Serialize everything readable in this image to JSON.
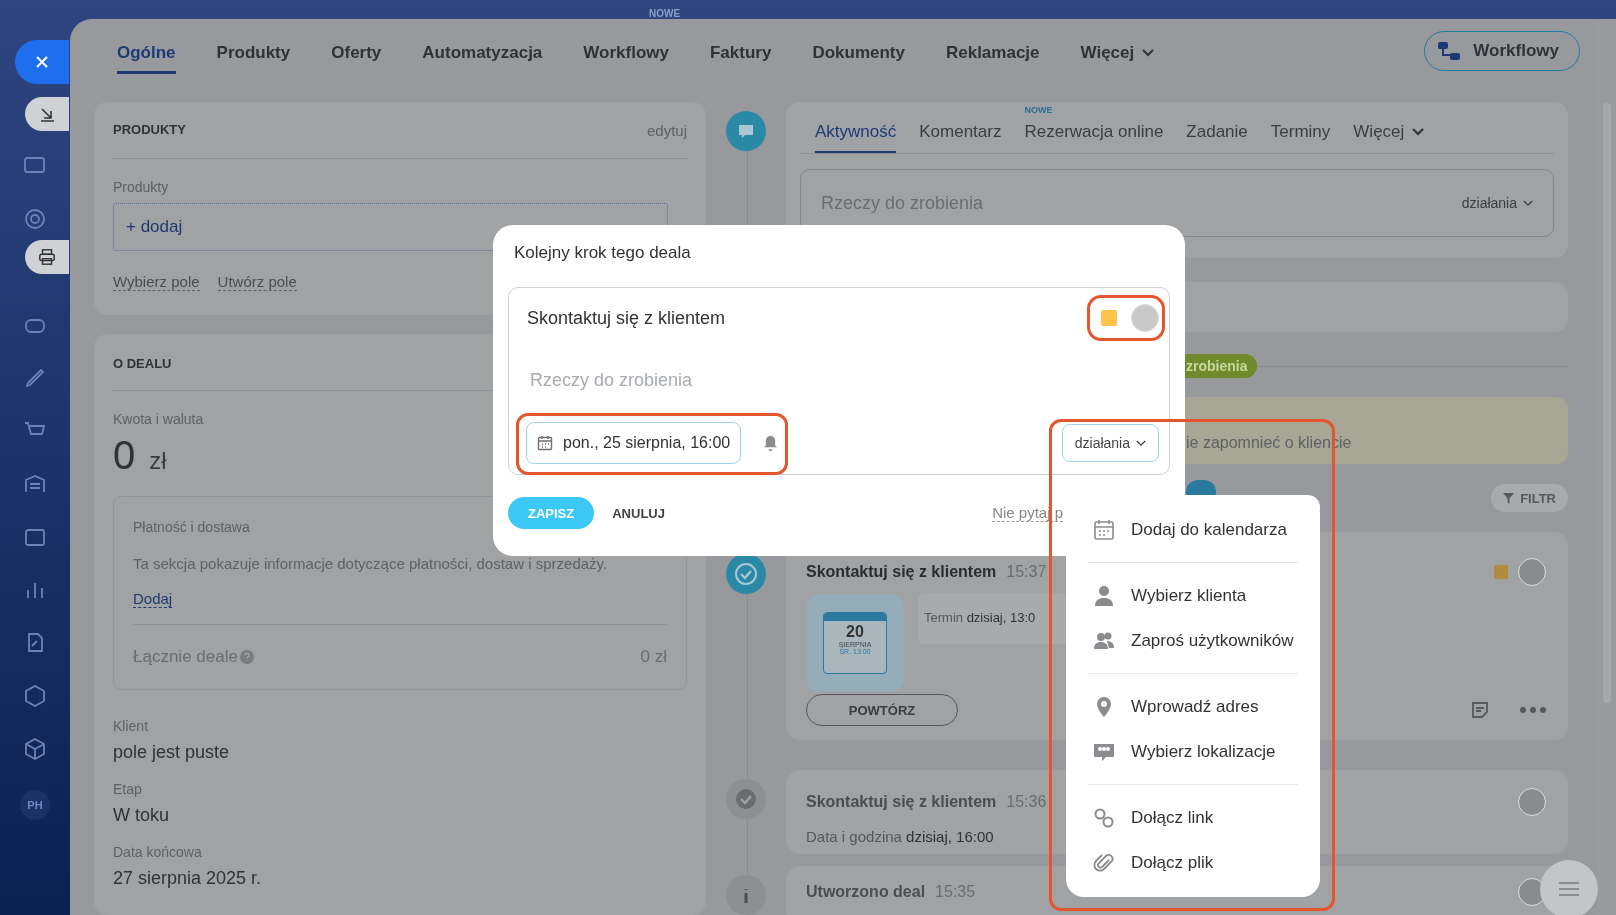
{
  "top_badge": "NOWE",
  "sidebar": {
    "badge": "PH"
  },
  "tabs": [
    {
      "label": "Ogólne",
      "selected": true
    },
    {
      "label": "Produkty",
      "selected": false
    },
    {
      "label": "Oferty",
      "selected": false
    },
    {
      "label": "Automatyzacja",
      "selected": false
    },
    {
      "label": "Workflowy",
      "selected": false
    },
    {
      "label": "Faktury",
      "selected": false
    },
    {
      "label": "Dokumenty",
      "selected": false
    },
    {
      "label": "Reklamacje",
      "selected": false
    },
    {
      "label": "Więcej",
      "selected": false,
      "kind": "more"
    }
  ],
  "workflow_button": "Workflowy",
  "products_card": {
    "title": "PRODUKTY",
    "edit": "edytuj",
    "field_label": "Produkty",
    "add": "+ dodaj",
    "links": [
      "Wybierz pole",
      "Utwórz pole"
    ]
  },
  "deal_card": {
    "title": "O DEALU",
    "amount_label": "Kwota i waluta",
    "amount": "0",
    "currency": "zł",
    "payment": {
      "title": "Płatność i dostawa",
      "text": "Ta sekcja pokazuje informacje dotyczące płatności, dostaw i sprzedaży.",
      "link": "Dodaj",
      "total_label": "Łącznie deale",
      "total": "0 zł"
    },
    "fields": [
      {
        "label": "Klient",
        "value": "pole jest puste"
      },
      {
        "label": "Etap",
        "value": "W toku"
      },
      {
        "label": "Data końcowa",
        "value": "27 sierpnia 2025 r."
      }
    ]
  },
  "activity": {
    "tabs": [
      {
        "label": "Aktywność",
        "selected": true
      },
      {
        "label": "Komentarz",
        "selected": false
      },
      {
        "label": "Rezerwacja online",
        "selected": false,
        "badge": "NOWE"
      },
      {
        "label": "Zadanie",
        "selected": false
      },
      {
        "label": "Terminy",
        "selected": false
      },
      {
        "label": "Więcej",
        "selected": false,
        "kind": "more"
      }
    ],
    "placeholder": "Rzeczy do zrobienia",
    "actions": "działania"
  },
  "timeline": {
    "stage_badge": "zrobienia",
    "note": "ie zapomnieć o kliencie",
    "filter": "FILTR",
    "items": [
      {
        "kind": "task",
        "title": "Skontaktuj się z klientem",
        "time": "15:37",
        "calendar": {
          "day": "20",
          "month": "SIERPNIA",
          "weekday": "ŚR. 13:00"
        },
        "deadline_label": "Termin",
        "deadline": "dzisiaj, 13:0",
        "repeat": "POWTÓRZ"
      },
      {
        "kind": "done",
        "title": "Skontaktuj się z klientem",
        "time": "15:36",
        "detail_label": "Data i godzina",
        "detail": "dzisiaj, 16:00"
      },
      {
        "kind": "info",
        "title": "Utworzono deal",
        "time": "15:35"
      }
    ]
  },
  "modal": {
    "title": "Kolejny krok tego deala",
    "task": "Skontaktuj się z klientem",
    "placeholder": "Rzeczy do zrobienia",
    "date": "pon., 25 sierpnia, 16:00",
    "actions": "działania",
    "save": "ZAPISZ",
    "cancel": "ANULUJ",
    "dont_ask": "Nie pytaj p"
  },
  "menu": {
    "sections": [
      [
        "Dodaj do kalendarza"
      ],
      [
        "Wybierz klienta",
        "Zaproś użytkowników"
      ],
      [
        "Wprowadź adres",
        "Wybierz lokalizacje"
      ],
      [
        "Dołącz link",
        "Dołącz plik"
      ]
    ]
  }
}
